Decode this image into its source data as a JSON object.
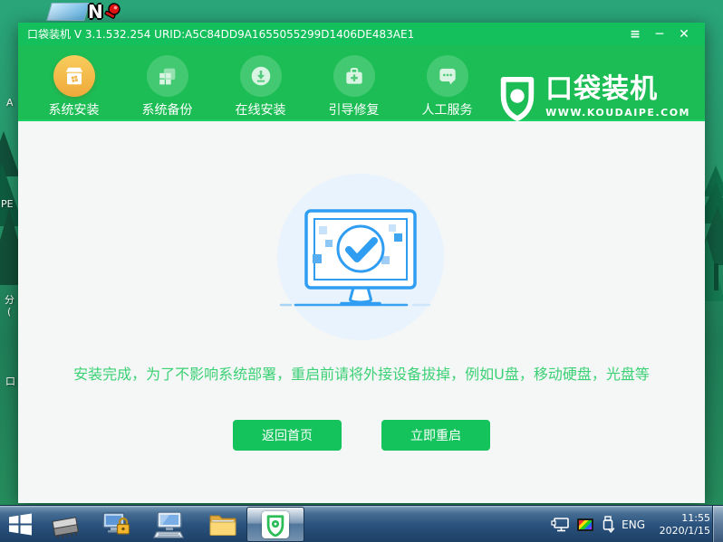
{
  "desktop": {
    "top_icons": {
      "display_icon": "blue-display-icon",
      "n_key_label": "N",
      "n_key_icon": "red-key-icon"
    },
    "edge_labels": {
      "l1": "A",
      "l2": "PE",
      "l3": "分",
      "l4": "(",
      "l5": "口"
    }
  },
  "window": {
    "title": "口袋装机 V 3.1.532.254 URID:A5C84DD9A1655055299D1406DE483AE1",
    "controls": {
      "menu": "≡",
      "minimize": "─",
      "close": "✕"
    },
    "nav": {
      "items": [
        {
          "label": "系统安装",
          "icon": "install-box-icon",
          "active": true
        },
        {
          "label": "系统备份",
          "icon": "backup-windows-icon",
          "active": false
        },
        {
          "label": "在线安装",
          "icon": "online-download-icon",
          "active": false
        },
        {
          "label": "引导修复",
          "icon": "boot-repair-toolbox-icon",
          "active": false
        },
        {
          "label": "人工服务",
          "icon": "support-chat-icon",
          "active": false
        }
      ]
    },
    "logo": {
      "brand": "口袋装机",
      "site": "WWW.KOUDAIPE.COM",
      "icon": "shield-dot-icon"
    },
    "content": {
      "illustration": "monitor-checkmark-illustration",
      "message": "安装完成，为了不影响系统部署，重启前请将外接设备拔掉，例如U盘，移动硬盘，光盘等",
      "home_button": "返回首页",
      "restart_button": "立即重启"
    }
  },
  "taskbar": {
    "start": "windows-start-icon",
    "apps": [
      "memory-chip-icon",
      "monitor-lock-icon",
      "monitor-keyboard-icon",
      "folder-icon",
      "koudai-shield-icon"
    ],
    "tray_icons": [
      "network-display-icon",
      "color-display-icon",
      "usb-drive-icon"
    ],
    "language": "ENG",
    "time": "11:55",
    "date": "2020/1/15"
  },
  "colors": {
    "brand_green": "#14c05c",
    "navbar_green": "#1cbd55",
    "active_orange": "#efa93a",
    "message_green": "#3bd175",
    "illustration_blue": "#2e9df2",
    "taskbar_blue": "#2c547e",
    "desktop_green": "#27986c"
  }
}
